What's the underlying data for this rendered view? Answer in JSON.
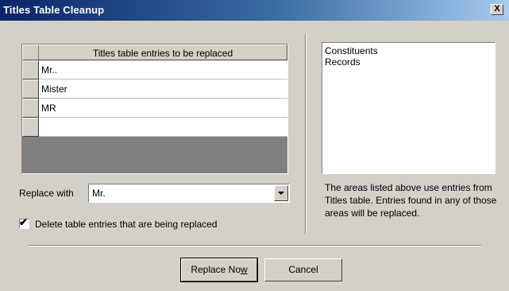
{
  "window": {
    "title": "Titles Table Cleanup",
    "close_glyph": "X"
  },
  "grid": {
    "header": "Titles table entries to be replaced",
    "rows": [
      "Mr..",
      "Mister",
      "MR",
      ""
    ]
  },
  "areas": {
    "items": [
      "Constituents",
      "Records"
    ]
  },
  "note": "The areas listed above use entries from Titles table. Entries found in any of those areas will be replaced.",
  "replace_with": {
    "label": "Replace with",
    "value": "Mr."
  },
  "delete_option": {
    "label": "Delete table entries that are being replaced",
    "checked": true
  },
  "buttons": {
    "replace_prefix": "Replace No",
    "replace_mnemonic": "w",
    "cancel": "Cancel"
  }
}
